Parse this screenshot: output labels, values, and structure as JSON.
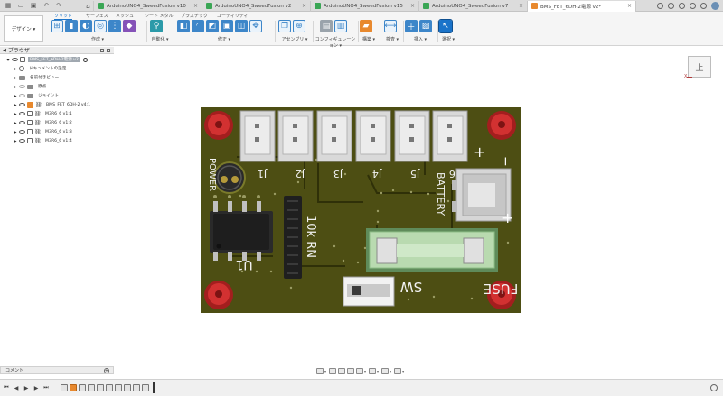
{
  "tabs": {
    "items": [
      {
        "label": "ArduinoUNO4_SweedFusion v10",
        "active": false
      },
      {
        "label": "ArduinoUNO4_SweedFusion v2",
        "active": false
      },
      {
        "label": "ArduinoUNO4_SweedFusion v15",
        "active": false
      },
      {
        "label": "ArduinoUNO4_SweedFusion v7",
        "active": false
      },
      {
        "label": "BMS_FET_6DH-2電源 v2*",
        "active": true
      }
    ]
  },
  "ribbon": {
    "workspace": "デザイン ▾",
    "tabs": [
      "ソリッド",
      "サーフェス",
      "メッシュ",
      "シート メタル",
      "プラスチック",
      "ユーティリティ"
    ],
    "groups": [
      "作成 ▾",
      "自動化 ▾",
      "修正 ▾",
      "アセンブリ ▾",
      "コンフィギュレーション ▾",
      "構築 ▾",
      "検査 ▾",
      "挿入 ▾",
      "選択 ▾"
    ]
  },
  "browser": {
    "title": "ブラウザ",
    "root": "BMS_FET_6DH-2電源 v2",
    "items": [
      {
        "label": "ドキュメントの設定",
        "icon": "gear"
      },
      {
        "label": "名前付きビュー",
        "icon": "folder"
      },
      {
        "label": "原点",
        "icon": "folder"
      },
      {
        "label": "ジョイント",
        "icon": "folder"
      },
      {
        "label": "BMS_FET_6DH-2 v4:1",
        "icon": "component"
      },
      {
        "label": "M3R6_6 v1:1",
        "icon": "link"
      },
      {
        "label": "M3R6_6 v1:2",
        "icon": "link"
      },
      {
        "label": "M3R6_6 v1:3",
        "icon": "link"
      },
      {
        "label": "M3R6_6 v1:4",
        "icon": "link"
      }
    ]
  },
  "viewcube": {
    "face": "上",
    "axis": "X"
  },
  "comments": {
    "label": "コメント"
  },
  "pcb": {
    "connectors": [
      "J1",
      "J2",
      "J3",
      "J4",
      "J5",
      "J6"
    ],
    "power_label": "POWER",
    "battery_label": "BATTERY",
    "resistor_label": "10k RN",
    "u1_label": "U1",
    "fuse_label": "FUSE",
    "sw_label": "SW",
    "plus": "+",
    "minus": "−",
    "colors": {
      "board": "#4e4f12",
      "mounting_pad": "#c62828",
      "connector": "#dcdcdc",
      "fuse_holder": "#b8d9b0"
    }
  }
}
